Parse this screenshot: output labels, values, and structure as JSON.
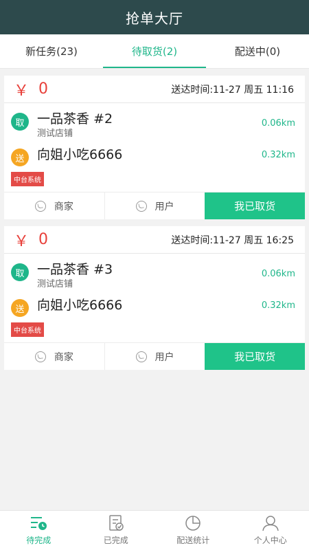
{
  "header": {
    "title": "抢单大厅"
  },
  "tabs": [
    {
      "label": "新任务(23)"
    },
    {
      "label": "待取货(2)"
    },
    {
      "label": "配送中(0)"
    }
  ],
  "orders": [
    {
      "currency": "￥",
      "price": "0",
      "deadline": "送达时间:11-27 周五 11:16",
      "pickup": {
        "badge": "取",
        "name": "一品茶香  #2",
        "sub": "测试店铺",
        "distance": "0.06km"
      },
      "delivery": {
        "badge": "送",
        "name": "向姐小吃6666",
        "distance": "0.32km"
      },
      "tag": "中台系统",
      "actions": {
        "merchant": "商家",
        "user": "用户",
        "confirm": "我已取货"
      }
    },
    {
      "currency": "￥",
      "price": "0",
      "deadline": "送达时间:11-27 周五 16:25",
      "pickup": {
        "badge": "取",
        "name": "一品茶香  #3",
        "sub": "测试店铺",
        "distance": "0.06km"
      },
      "delivery": {
        "badge": "送",
        "name": "向姐小吃6666",
        "distance": "0.32km"
      },
      "tag": "中台系统",
      "actions": {
        "merchant": "商家",
        "user": "用户",
        "confirm": "我已取货"
      }
    }
  ],
  "bottom_nav": [
    {
      "label": "待完成",
      "icon": "pending-list-icon"
    },
    {
      "label": "已完成",
      "icon": "completed-doc-icon"
    },
    {
      "label": "配送统计",
      "icon": "pie-chart-icon"
    },
    {
      "label": "个人中心",
      "icon": "user-icon"
    }
  ],
  "colors": {
    "primary": "#1fb68a",
    "header": "#2d4a4c",
    "price": "#e8403a",
    "send_badge": "#f5a623",
    "tag": "#e34b47"
  }
}
